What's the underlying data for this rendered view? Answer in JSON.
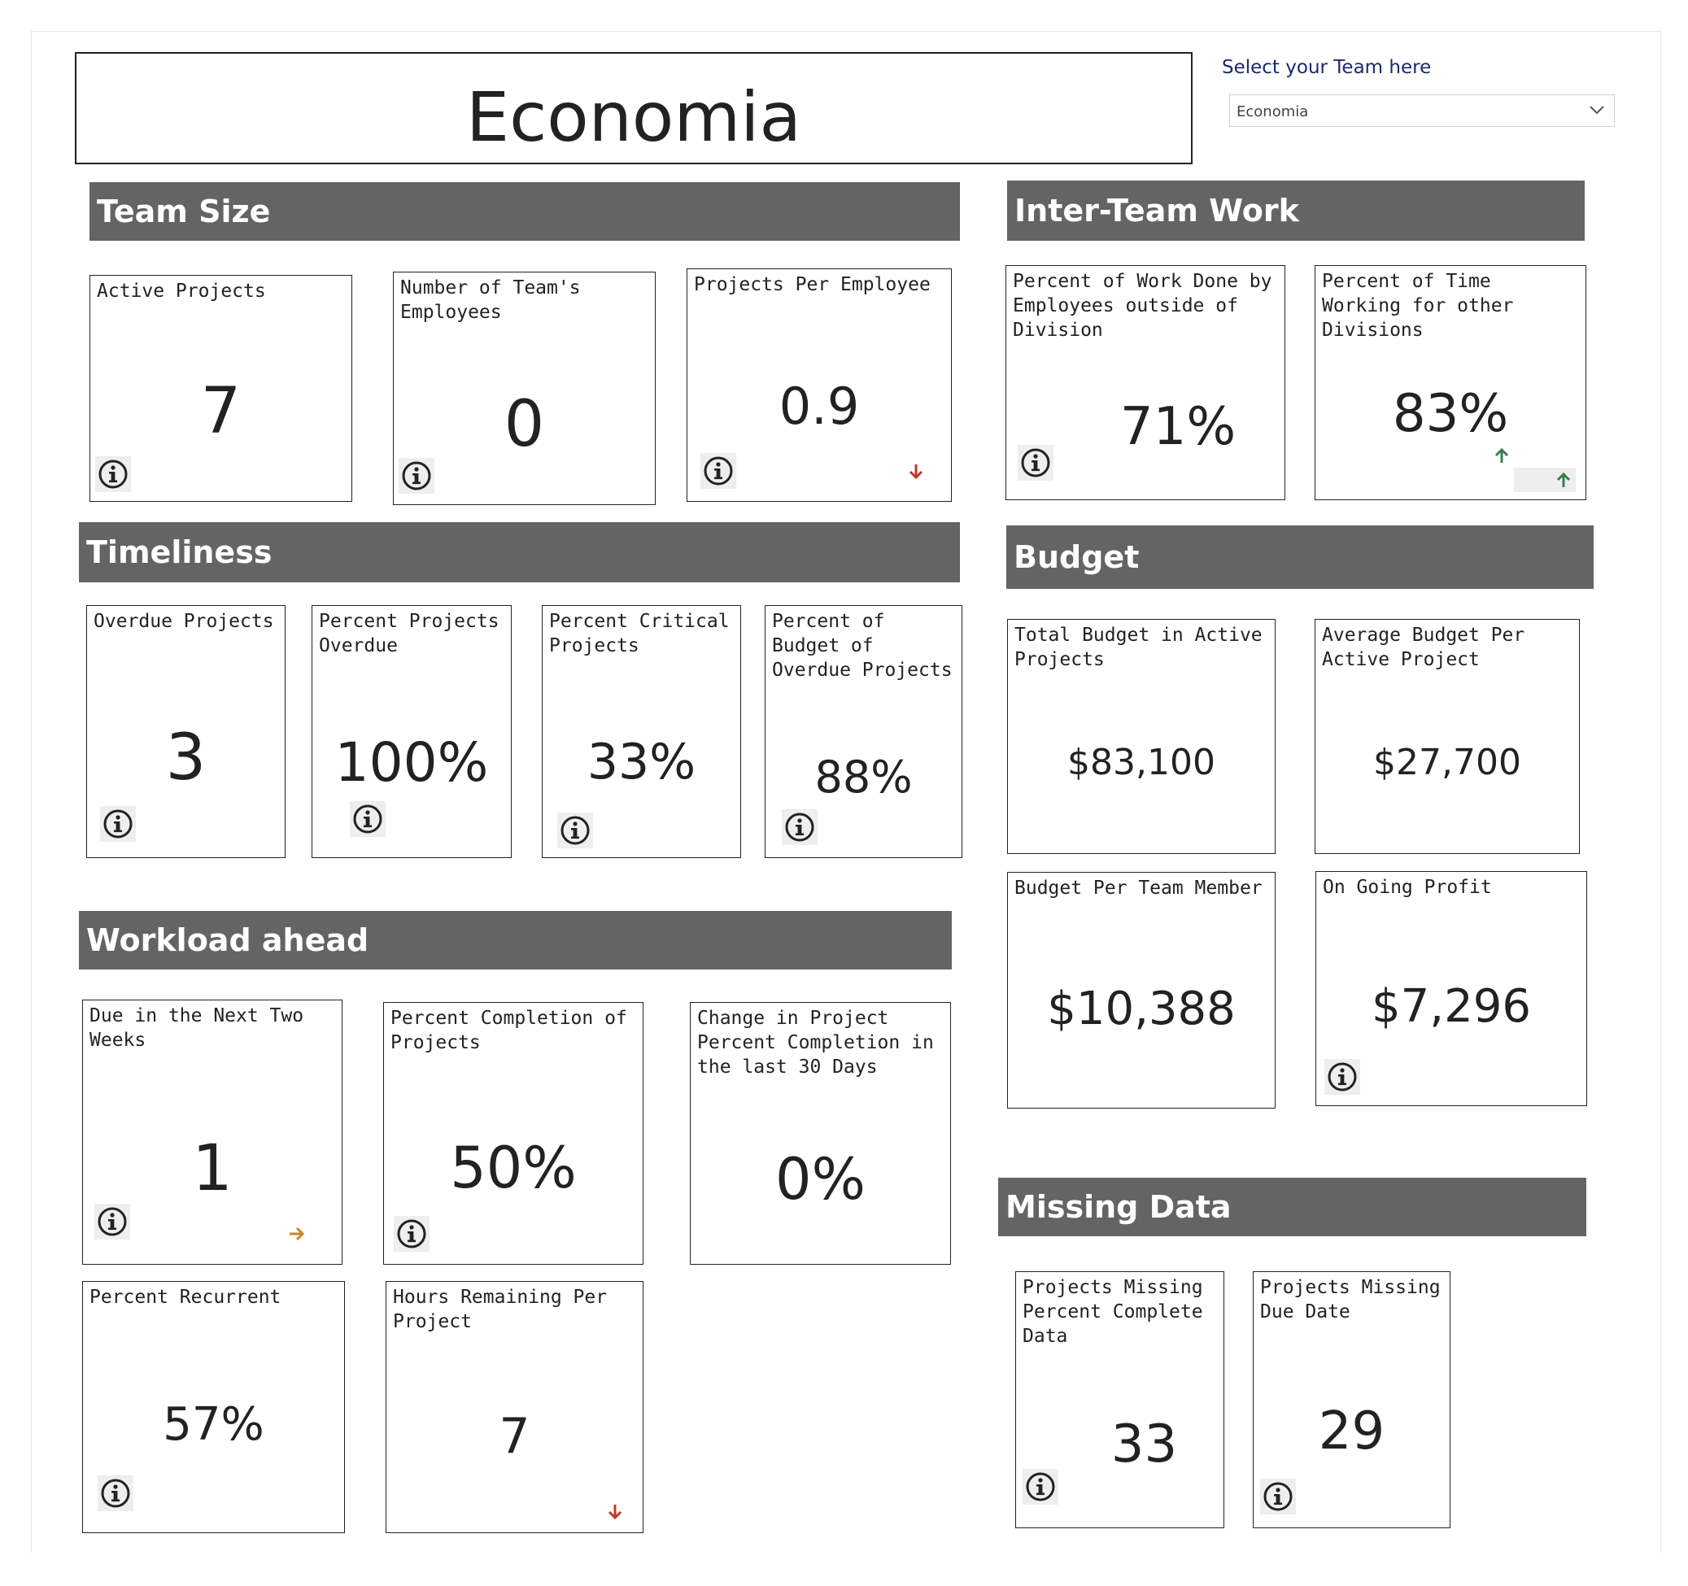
{
  "title": "Economia",
  "team_selector": {
    "label": "Select your Team here",
    "value": "Economia"
  },
  "sections": {
    "team_size": "Team Size",
    "inter_team": "Inter-Team Work",
    "timeliness": "Timeliness",
    "budget": "Budget",
    "workload": "Workload ahead",
    "missing": "Missing Data"
  },
  "cards": {
    "active_projects": {
      "title": "Active Projects",
      "value": "7"
    },
    "team_employees": {
      "title": "Number of Team's Employees",
      "value": "0"
    },
    "projects_per_employee": {
      "title": "Projects Per Employee",
      "value": "0.9",
      "trend": "down"
    },
    "work_outside_division": {
      "title": "Percent of Work Done by Employees outside of Division",
      "value": "71%"
    },
    "time_other_divisions": {
      "title": "Percent of Time Working for other Divisions",
      "value": "83%",
      "trend": "up"
    },
    "overdue_projects": {
      "title": "Overdue Projects",
      "value": "3"
    },
    "percent_overdue": {
      "title": "Percent Projects Overdue",
      "value": "100%"
    },
    "percent_critical": {
      "title": "Percent Critical Projects",
      "value": "33%"
    },
    "budget_overdue": {
      "title": "Percent of Budget of Overdue Projects",
      "value": "88%"
    },
    "total_budget": {
      "title": "Total Budget in Active Projects",
      "value": "$83,100"
    },
    "avg_budget": {
      "title": "Average Budget Per Active Project",
      "value": "$27,700"
    },
    "budget_per_member": {
      "title": "Budget Per Team Member",
      "value": "$10,388"
    },
    "ongoing_profit": {
      "title": "On Going Profit",
      "value": "$7,296"
    },
    "due_two_weeks": {
      "title": "Due in the Next Two Weeks",
      "value": "1",
      "trend": "flat"
    },
    "percent_completion": {
      "title": "Percent Completion of Projects",
      "value": "50%"
    },
    "change_completion": {
      "title": "Change in Project Percent Completion in the last 30 Days",
      "value": "0%"
    },
    "percent_recurrent": {
      "title": "Percent Recurrent",
      "value": "57%"
    },
    "hours_remaining": {
      "title": "Hours Remaining Per Project",
      "value": "7",
      "trend": "down"
    },
    "missing_percent": {
      "title": "Projects Missing Percent Complete Data",
      "value": "33"
    },
    "missing_due": {
      "title": "Projects Missing Due Date",
      "value": "29"
    }
  },
  "colors": {
    "section_bg": "#646464",
    "trend_down": "#c0392b",
    "trend_up": "#3a7d4f",
    "trend_flat": "#c8862a"
  },
  "icons": {
    "info": "info-circle-icon",
    "dropdown": "chevron-down-icon"
  }
}
